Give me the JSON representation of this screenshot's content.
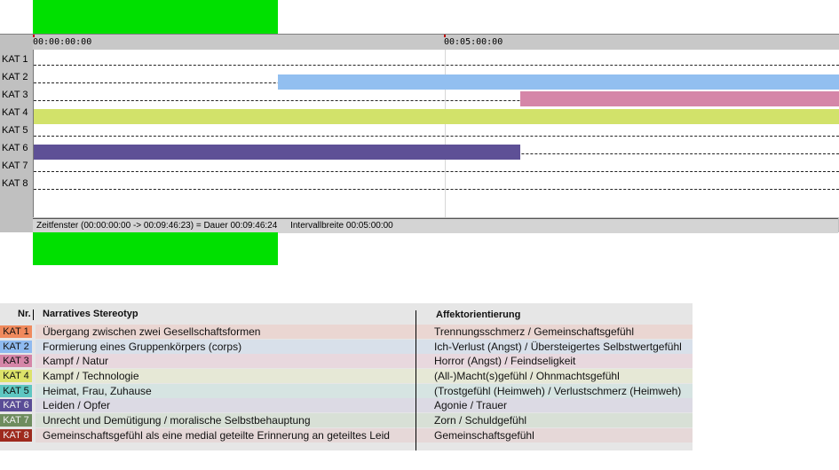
{
  "ruler": {
    "ticks": [
      "00:00:00:00",
      "00:05:00:00"
    ]
  },
  "timeline": {
    "rows": [
      "KAT 1",
      "KAT 2",
      "KAT 3",
      "KAT 4",
      "KAT 5",
      "KAT 6",
      "KAT 7",
      "KAT 8"
    ],
    "status": "Zeitfenster (00:00:00:00 -> 00:09:46:23) = Dauer 00:09:46:24",
    "interval": "Intervallbreite 00:05:00:00"
  },
  "legend": {
    "header_nr": "Nr.",
    "header_stereotype": "Narratives Stereotyp",
    "header_affect": "Affektorientierung",
    "rows": [
      {
        "nr": "KAT 1",
        "stereotype": "Übergang zwischen zwei Gesellschaftsformen",
        "affect": "Trennungsschmerz / Gemeinschaftsgefühl",
        "swatch": "#f08a5d",
        "band": "#ead6d2"
      },
      {
        "nr": "KAT 2",
        "stereotype": "Formierung eines Gruppenkörpers (corps)",
        "affect": "Ich-Verlust (Angst) / Übersteigertes Selbstwertgefühl",
        "swatch": "#8fbaf0",
        "band": "#d8e0ea"
      },
      {
        "nr": "KAT 3",
        "stereotype": "Kampf / Natur",
        "affect": "Horror (Angst) / Feindseligkeit",
        "swatch": "#d586a8",
        "band": "#e8d8de"
      },
      {
        "nr": "KAT 4",
        "stereotype": "Kampf / Technologie",
        "affect": "(All-)Macht(s)gefühl / Ohnmachtsgefühl",
        "swatch": "#dde36a",
        "band": "#e6e8d6"
      },
      {
        "nr": "KAT 5",
        "stereotype": "Heimat, Frau, Zuhause",
        "affect": "(Trostgefühl (Heimweh) / Verlustschmerz (Heimweh)",
        "swatch": "#5ec7c2",
        "band": "#d6e4e2"
      },
      {
        "nr": "KAT 6",
        "stereotype": "Leiden / Opfer",
        "affect": "Agonie / Trauer",
        "swatch": "#5a4c96",
        "band": "#dcdae4"
      },
      {
        "nr": "KAT 7",
        "stereotype": "Unrecht und Demütigung / moralische Selbstbehauptung",
        "affect": "Zorn / Schuldgefühl",
        "swatch": "#6e8c5e",
        "band": "#d8e0d6"
      },
      {
        "nr": "KAT 8",
        "stereotype": "Gemeinschaftsgefühl als eine medial geteilte Erinnerung an geteiltes Leid",
        "affect": "Gemeinschaftsgefühl",
        "swatch": "#9e2a1e",
        "band": "#e6d8d8"
      }
    ]
  },
  "colors": {
    "kat2_bar": "#92bff0",
    "kat3_bar": "#d586a8",
    "kat4_bar": "#d2e26a",
    "kat6_bar": "#5e5096",
    "window_marker": "#00e000"
  }
}
